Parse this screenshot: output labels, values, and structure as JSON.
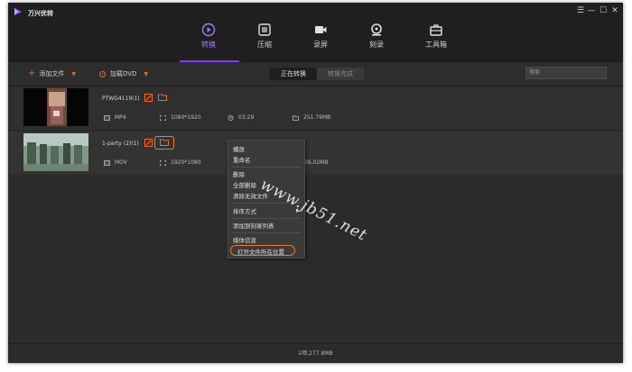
{
  "app": {
    "name": "万兴优转",
    "accent": "#7c3cff",
    "orange": "#f06a2c"
  },
  "window_controls": [
    {
      "icon": "menu-icon",
      "glyph": "☰"
    },
    {
      "icon": "minimize-icon",
      "glyph": "—"
    },
    {
      "icon": "maximize-icon",
      "glyph": "☐"
    },
    {
      "icon": "close-icon",
      "glyph": "✕"
    }
  ],
  "nav": [
    {
      "label": "转换",
      "icon": "convert-icon",
      "active": true
    },
    {
      "label": "压缩",
      "icon": "compress-icon",
      "active": false
    },
    {
      "label": "录屏",
      "icon": "record-icon",
      "active": false
    },
    {
      "label": "刻录",
      "icon": "burn-icon",
      "active": false
    },
    {
      "label": "工具箱",
      "icon": "toolbox-icon",
      "active": false
    }
  ],
  "toolbar": {
    "add_file": "添加文件",
    "load_dvd": "加载DVD",
    "tab_converting": "正在转换",
    "tab_done": "转换完成",
    "search_placeholder": "搜索"
  },
  "files": [
    {
      "name": "PTWG4119(1)",
      "format": "MP4",
      "resolution": "1080*1920",
      "duration": "03:29",
      "size": "251.79MB"
    },
    {
      "name": "1-party (2)(1)",
      "format": "MOV",
      "resolution": "1920*1080",
      "size": "26.02MB"
    }
  ],
  "context_menu": {
    "items": [
      "播放",
      "重命名",
      "删除",
      "全部删除",
      "清除无效文件",
      "排序方式",
      "添加到刻录列表",
      "媒体信息",
      "打开文件所在位置"
    ],
    "highlighted": "打开文件所在位置"
  },
  "footer": {
    "summary": "2项,277.8MB"
  },
  "watermark": "www.jb51.net"
}
